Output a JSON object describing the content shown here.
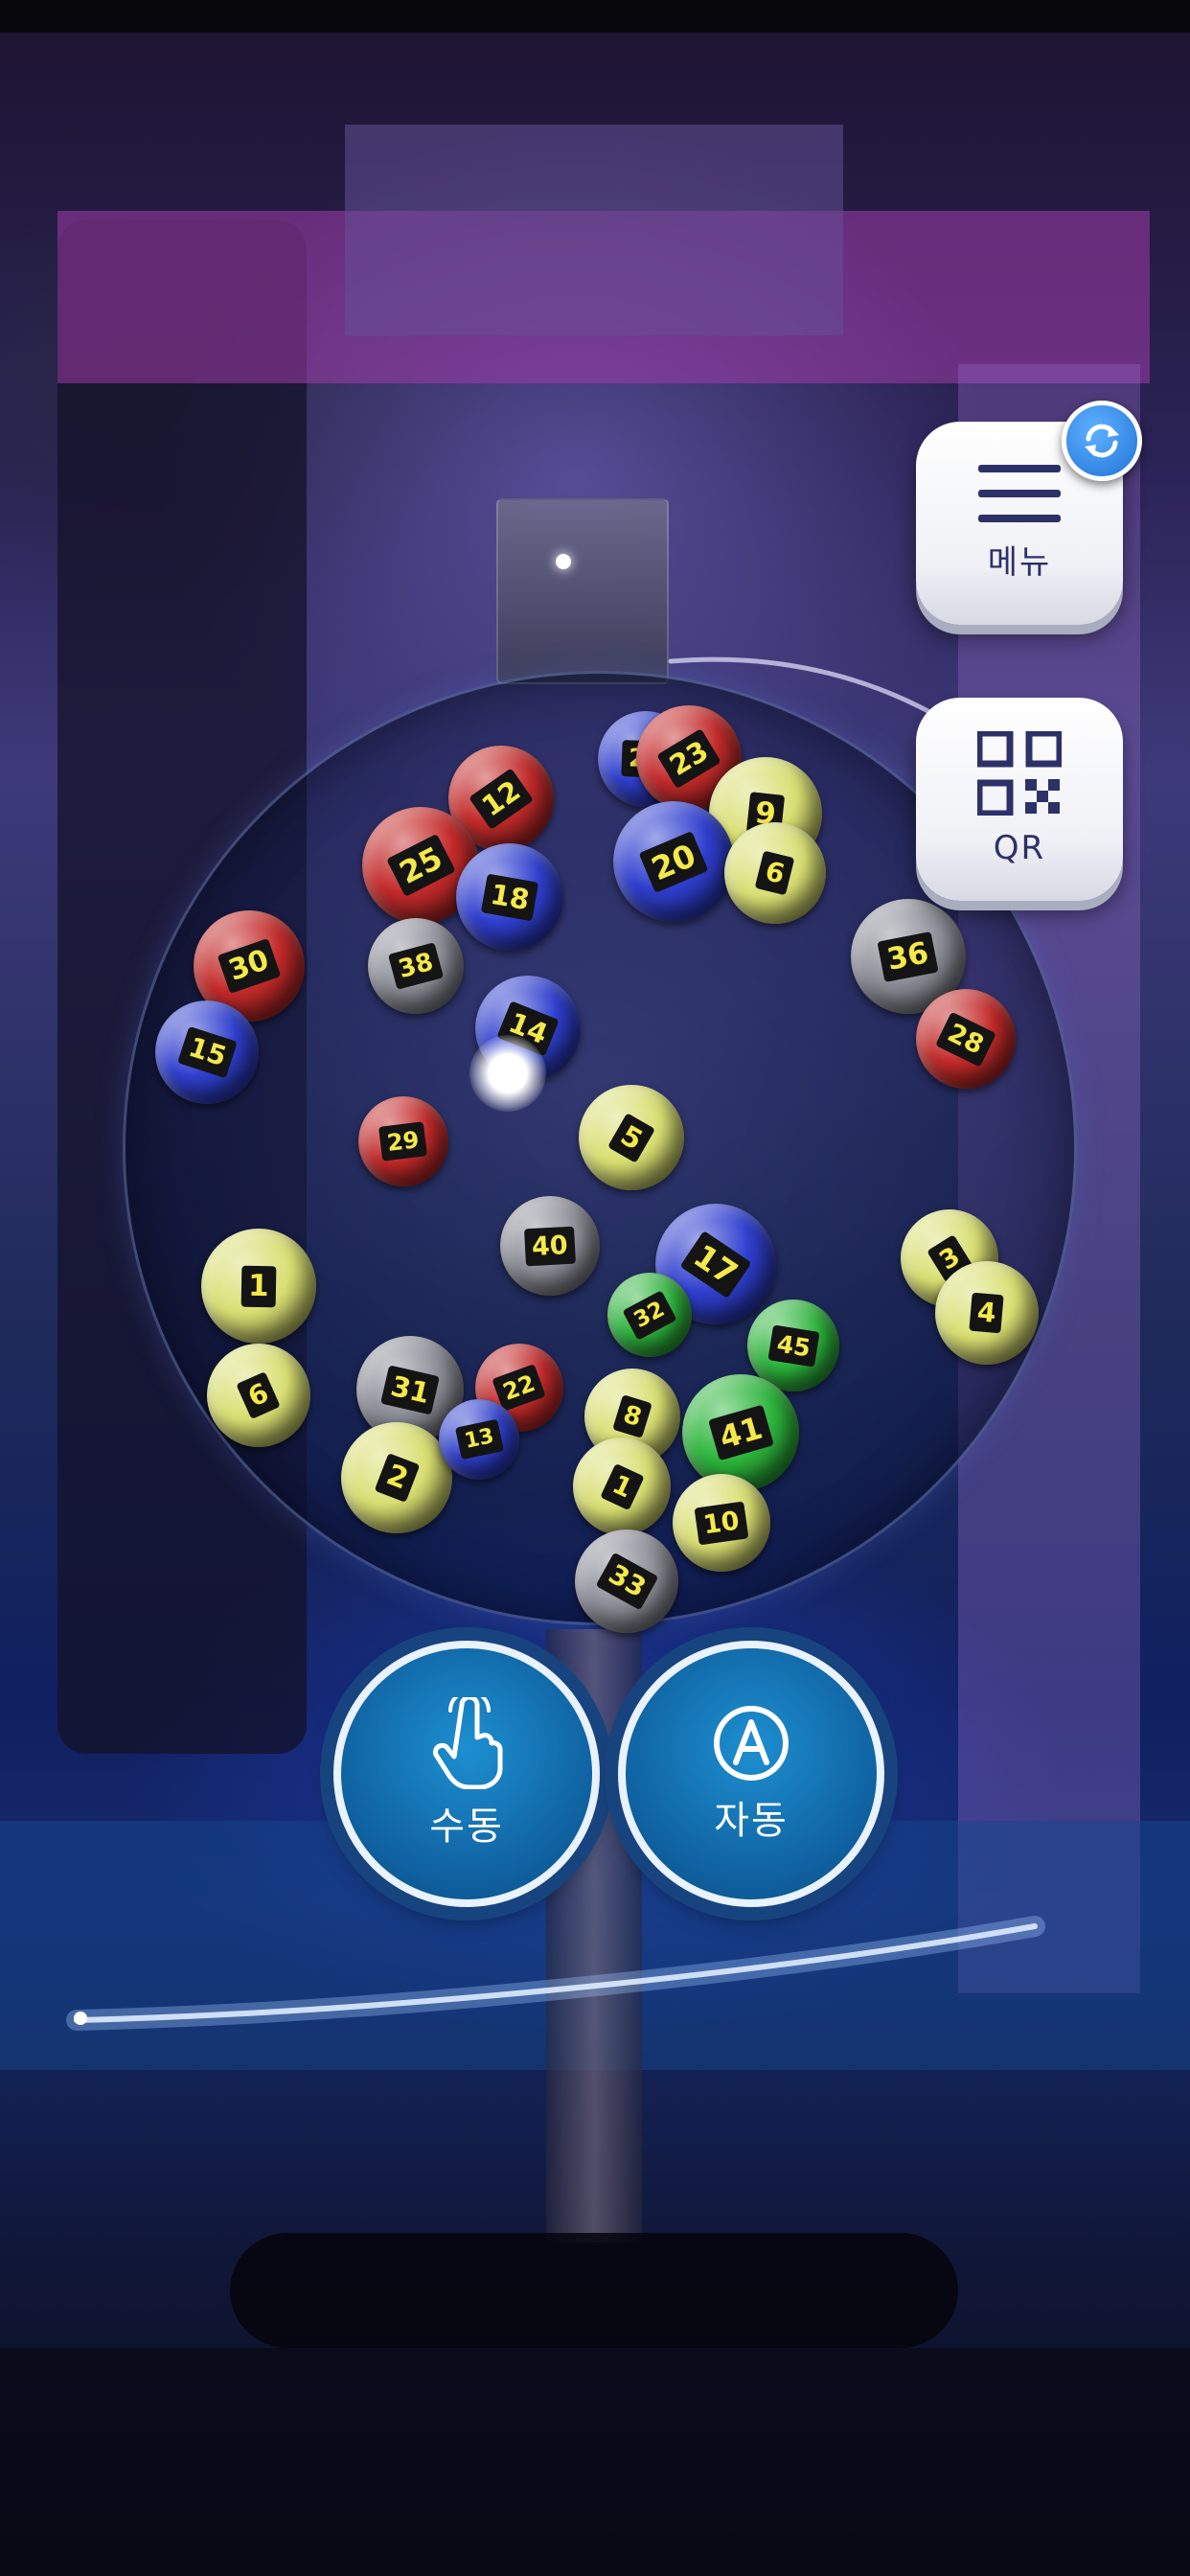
{
  "side_menu": {
    "menu_label": "메뉴",
    "qr_label": "QR",
    "badge_icon": "refresh-arrows-icon"
  },
  "actions": {
    "manual_label": "수동",
    "manual_icon": "touch-hand-icon",
    "auto_label": "자동",
    "auto_icon": "letter-a-circle-icon"
  },
  "balls": [
    {
      "number": "12",
      "color": "#c42a2a"
    },
    {
      "number": "21",
      "color": "#2f3fcf"
    },
    {
      "number": "23",
      "color": "#c42a2a"
    },
    {
      "number": "9",
      "color": "#d9df72"
    },
    {
      "number": "25",
      "color": "#c42a2a"
    },
    {
      "number": "18",
      "color": "#2f3fcf"
    },
    {
      "number": "20",
      "color": "#2f3fcf"
    },
    {
      "number": "6",
      "color": "#d9df72"
    },
    {
      "number": "30",
      "color": "#c42a2a"
    },
    {
      "number": "15",
      "color": "#2f3fcf"
    },
    {
      "number": "38",
      "color": "#8d8f98"
    },
    {
      "number": "14",
      "color": "#2f3fcf"
    },
    {
      "number": "36",
      "color": "#8d8f98"
    },
    {
      "number": "28",
      "color": "#c42a2a"
    },
    {
      "number": "29",
      "color": "#c42a2a"
    },
    {
      "number": "5",
      "color": "#d9df72"
    },
    {
      "number": "40",
      "color": "#8d8f98"
    },
    {
      "number": "17",
      "color": "#2f3fcf"
    },
    {
      "number": "1",
      "color": "#d9df72"
    },
    {
      "number": "3",
      "color": "#d9df72"
    },
    {
      "number": "4",
      "color": "#d9df72"
    },
    {
      "number": "32",
      "color": "#2db53c"
    },
    {
      "number": "45",
      "color": "#2db53c"
    },
    {
      "number": "6",
      "color": "#d9df72"
    },
    {
      "number": "31",
      "color": "#8d8f98"
    },
    {
      "number": "22",
      "color": "#c42a2a"
    },
    {
      "number": "8",
      "color": "#d9df72"
    },
    {
      "number": "41",
      "color": "#2db53c"
    },
    {
      "number": "2",
      "color": "#d9df72"
    },
    {
      "number": "13",
      "color": "#2f3fcf"
    },
    {
      "number": "1",
      "color": "#d9df72"
    },
    {
      "number": "10",
      "color": "#d9df72"
    },
    {
      "number": "33",
      "color": "#8d8f98"
    }
  ]
}
